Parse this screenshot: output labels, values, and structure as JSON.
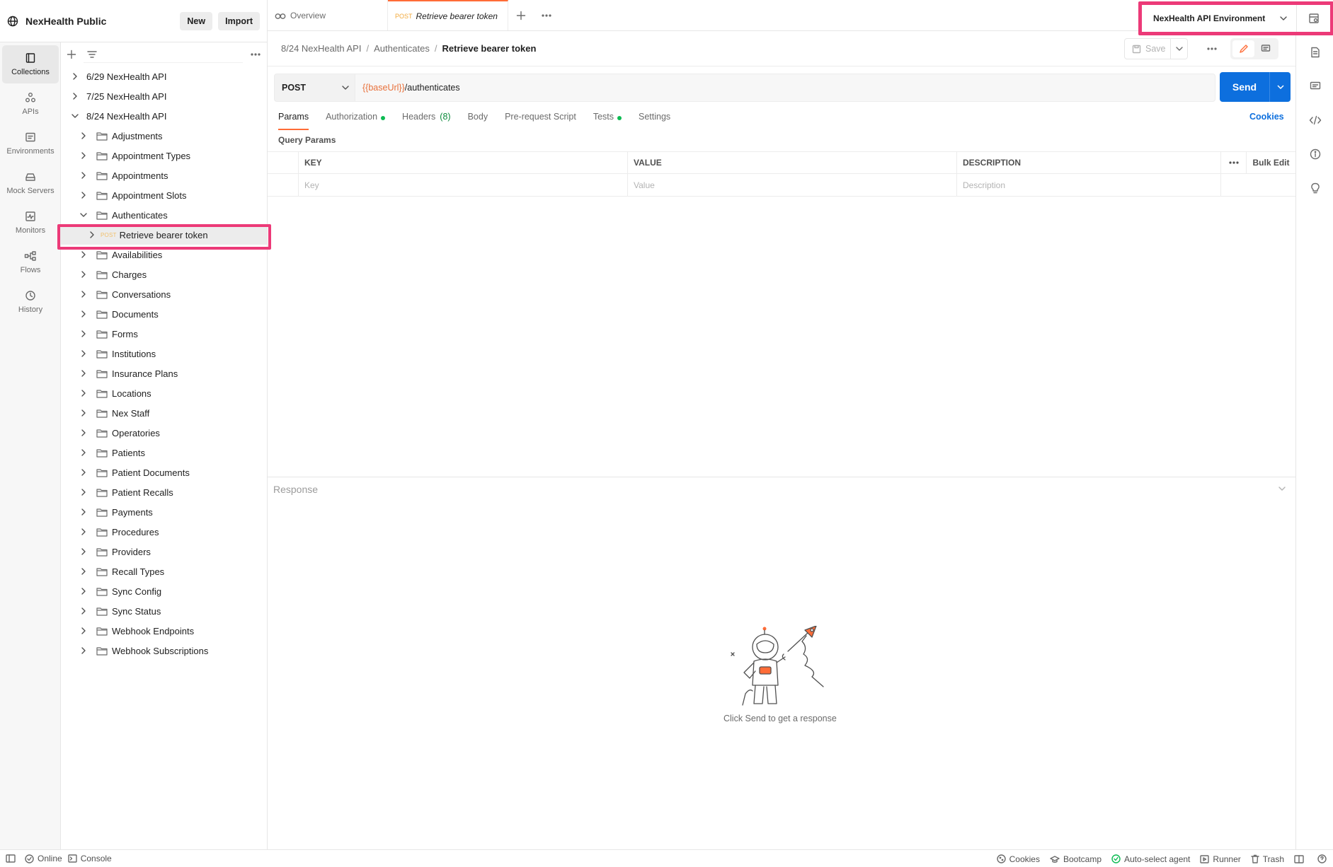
{
  "workspace": {
    "name": "NexHealth Public",
    "new_label": "New",
    "import_label": "Import"
  },
  "rail": [
    {
      "label": "Collections",
      "icon": "collections-icon",
      "active": true
    },
    {
      "label": "APIs",
      "icon": "apis-icon"
    },
    {
      "label": "Environments",
      "icon": "environments-icon"
    },
    {
      "label": "Mock Servers",
      "icon": "mock-servers-icon"
    },
    {
      "label": "Monitors",
      "icon": "monitors-icon"
    },
    {
      "label": "Flows",
      "icon": "flows-icon"
    },
    {
      "label": "History",
      "icon": "history-icon"
    }
  ],
  "sidebar": {
    "collections": [
      "6/29 NexHealth API",
      "7/25 NexHealth API",
      "8/24 NexHealth API"
    ],
    "folders_before": [
      "Adjustments",
      "Appointment Types",
      "Appointments",
      "Appointment Slots",
      "Authenticates"
    ],
    "request": {
      "method": "POST",
      "name": "Retrieve bearer token"
    },
    "folders_after": [
      "Availabilities",
      "Charges",
      "Conversations",
      "Documents",
      "Forms",
      "Institutions",
      "Insurance Plans",
      "Locations",
      "Nex Staff",
      "Operatories",
      "Patients",
      "Patient Documents",
      "Patient Recalls",
      "Payments",
      "Procedures",
      "Providers",
      "Recall Types",
      "Sync Config",
      "Sync Status",
      "Webhook Endpoints",
      "Webhook Subscriptions"
    ]
  },
  "tabs": {
    "overview": "Overview",
    "active_method": "POST",
    "active_name": "Retrieve bearer token"
  },
  "environment": {
    "selected": "NexHealth API Environment"
  },
  "breadcrumb": {
    "collection": "8/24 NexHealth API",
    "folder": "Authenticates",
    "request": "Retrieve bearer token",
    "sep": "/"
  },
  "save_label": "Save",
  "request": {
    "method": "POST",
    "url_var": "{{baseUrl}}",
    "url_path": "/authenticates",
    "send_label": "Send"
  },
  "request_tabs": {
    "params": "Params",
    "authorization": "Authorization",
    "headers": "Headers",
    "headers_count": "(8)",
    "body": "Body",
    "prerequest": "Pre-request Script",
    "tests": "Tests",
    "settings": "Settings",
    "cookies": "Cookies"
  },
  "params": {
    "title": "Query Params",
    "headers": {
      "key": "KEY",
      "value": "VALUE",
      "description": "DESCRIPTION",
      "bulk_edit": "Bulk Edit"
    },
    "placeholders": {
      "key": "Key",
      "value": "Value",
      "description": "Description"
    }
  },
  "response": {
    "title": "Response",
    "empty_text": "Click Send to get a response"
  },
  "statusbar": {
    "online": "Online",
    "console": "Console",
    "cookies": "Cookies",
    "bootcamp": "Bootcamp",
    "agent": "Auto-select agent",
    "runner": "Runner",
    "trash": "Trash"
  },
  "colors": {
    "accent": "#ff6c37",
    "send": "#0d6fde",
    "highlight": "#ec3a78",
    "url_var": "#e8703a",
    "dot_green": "#0cbb52"
  }
}
